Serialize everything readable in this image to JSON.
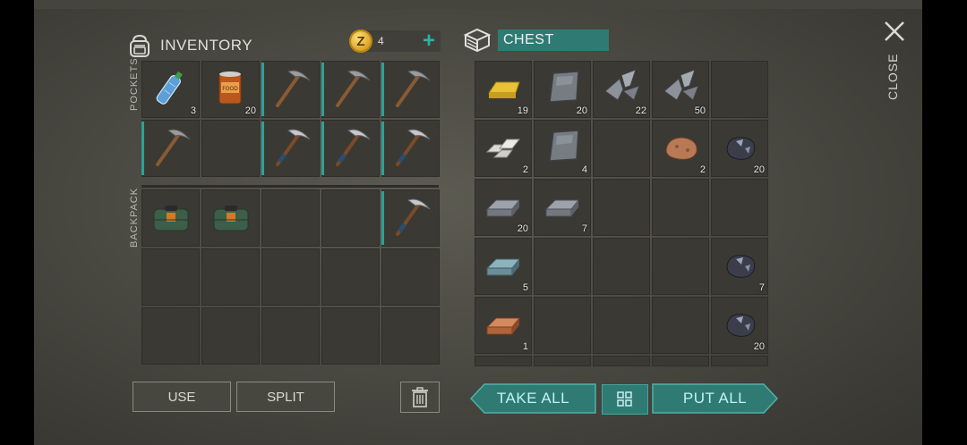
{
  "inventory": {
    "title": "INVENTORY",
    "pockets_label": "POCKETS",
    "backpack_label": "BACKPACK",
    "coins": "4",
    "pockets": [
      {
        "item": "water-bottle",
        "count": "3",
        "accent": false
      },
      {
        "item": "food-can",
        "count": "20",
        "accent": false
      },
      {
        "item": "pickaxe",
        "count": "",
        "accent": true
      },
      {
        "item": "pickaxe",
        "count": "",
        "accent": true
      },
      {
        "item": "pickaxe",
        "count": "",
        "accent": true
      },
      {
        "item": "pickaxe",
        "count": "",
        "accent": true
      },
      {
        "item": "",
        "count": "",
        "accent": false
      },
      {
        "item": "pickaxe-steel",
        "count": "",
        "accent": true
      },
      {
        "item": "pickaxe-steel",
        "count": "",
        "accent": true
      },
      {
        "item": "pickaxe-steel",
        "count": "",
        "accent": true
      }
    ],
    "backpack": [
      {
        "item": "bag",
        "count": ""
      },
      {
        "item": "bag",
        "count": ""
      },
      {
        "item": "",
        "count": ""
      },
      {
        "item": "",
        "count": ""
      },
      {
        "item": "pickaxe-steel",
        "count": "",
        "accent": true
      },
      {
        "item": "",
        "count": ""
      },
      {
        "item": "",
        "count": ""
      },
      {
        "item": "",
        "count": ""
      },
      {
        "item": "",
        "count": ""
      },
      {
        "item": "",
        "count": ""
      },
      {
        "item": "",
        "count": ""
      },
      {
        "item": "",
        "count": ""
      },
      {
        "item": "",
        "count": ""
      },
      {
        "item": "",
        "count": ""
      },
      {
        "item": "",
        "count": ""
      }
    ]
  },
  "chest": {
    "title": "CHEST",
    "slots": [
      {
        "item": "gold-bar",
        "count": "19"
      },
      {
        "item": "metal-plate",
        "count": "20"
      },
      {
        "item": "scrap-shards",
        "count": "22"
      },
      {
        "item": "scrap-shards",
        "count": "50"
      },
      {
        "item": "",
        "count": ""
      },
      {
        "item": "aluminum-bars",
        "count": "2"
      },
      {
        "item": "metal-plate",
        "count": "4"
      },
      {
        "item": "",
        "count": ""
      },
      {
        "item": "copper-ore",
        "count": "2"
      },
      {
        "item": "coal-ore",
        "count": "20"
      },
      {
        "item": "iron-ingot",
        "count": "20"
      },
      {
        "item": "iron-ingot",
        "count": "7"
      },
      {
        "item": "",
        "count": ""
      },
      {
        "item": "",
        "count": ""
      },
      {
        "item": "",
        "count": ""
      },
      {
        "item": "titanium-ingot",
        "count": "5"
      },
      {
        "item": "",
        "count": ""
      },
      {
        "item": "",
        "count": ""
      },
      {
        "item": "",
        "count": ""
      },
      {
        "item": "coal-ore",
        "count": "7"
      },
      {
        "item": "copper-ingot",
        "count": "1"
      },
      {
        "item": "",
        "count": ""
      },
      {
        "item": "",
        "count": ""
      },
      {
        "item": "",
        "count": ""
      },
      {
        "item": "coal-ore",
        "count": "20"
      }
    ]
  },
  "buttons": {
    "use": "USE",
    "split": "SPLIT",
    "take_all": "TAKE ALL",
    "put_all": "PUT ALL",
    "close": "CLOSE"
  },
  "colors": {
    "accent": "#2fa096",
    "teal_button": "#2f7b74"
  }
}
